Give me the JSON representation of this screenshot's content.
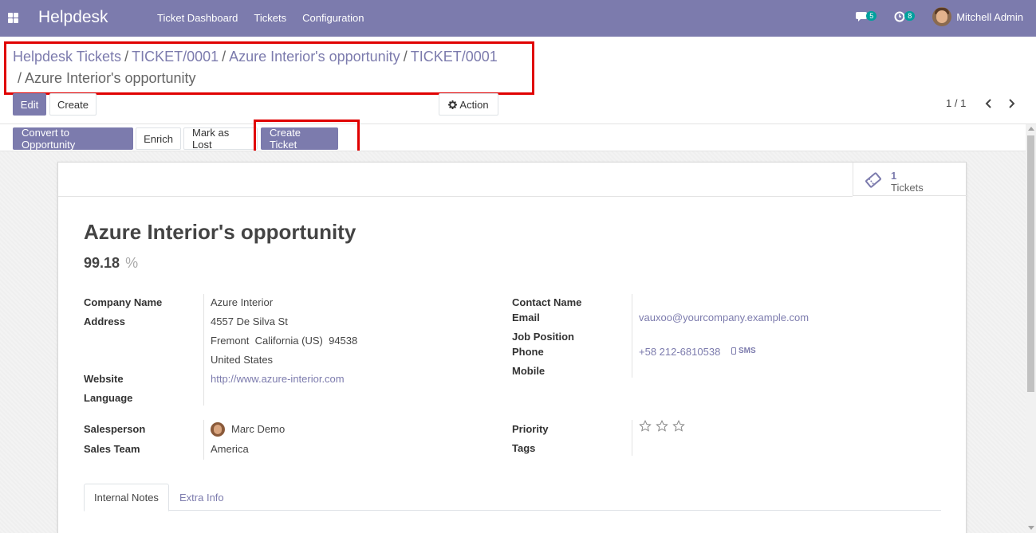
{
  "navbar": {
    "brand": "Helpdesk",
    "menu": [
      "Ticket Dashboard",
      "Tickets",
      "Configuration"
    ],
    "messages_count": "5",
    "activities_count": "8",
    "user_name": "Mitchell Admin"
  },
  "breadcrumb": {
    "items": [
      "Helpdesk Tickets",
      "TICKET/0001",
      "Azure Interior's opportunity",
      "TICKET/0001"
    ],
    "current": "Azure Interior's opportunity"
  },
  "control": {
    "edit_label": "Edit",
    "create_label": "Create",
    "action_label": "Action",
    "pager": "1 / 1"
  },
  "statusbar": {
    "convert_label": "Convert to Opportunity",
    "enrich_label": "Enrich",
    "lost_label": "Mark as Lost",
    "create_ticket_label": "Create Ticket"
  },
  "stat": {
    "count": "1",
    "label": "Tickets"
  },
  "record": {
    "title": "Azure Interior's opportunity",
    "probability": "99.18",
    "probability_unit": "%"
  },
  "left_fields": {
    "company_name_label": "Company Name",
    "company_name": "Azure Interior",
    "address_label": "Address",
    "address_line1": "4557 De Silva St",
    "address_line2": "Fremont  California (US)  94538",
    "address_line3": "United States",
    "website_label": "Website",
    "website": "http://www.azure-interior.com",
    "language_label": "Language"
  },
  "right_fields": {
    "contact_name_label": "Contact Name",
    "email_label": "Email",
    "email": "vauxoo@yourcompany.example.com",
    "job_position_label": "Job Position",
    "phone_label": "Phone",
    "phone": "+58 212-6810538",
    "sms_label": "SMS",
    "mobile_label": "Mobile"
  },
  "team_fields": {
    "salesperson_label": "Salesperson",
    "salesperson": "Marc Demo",
    "sales_team_label": "Sales Team",
    "sales_team": "America",
    "priority_label": "Priority",
    "priority_stars": 0,
    "priority_max": 3,
    "tags_label": "Tags"
  },
  "tabs": [
    "Internal Notes",
    "Extra Info"
  ],
  "colors": {
    "brand": "#7c7bad",
    "highlight": "#e00000",
    "badge": "#00a09d"
  }
}
